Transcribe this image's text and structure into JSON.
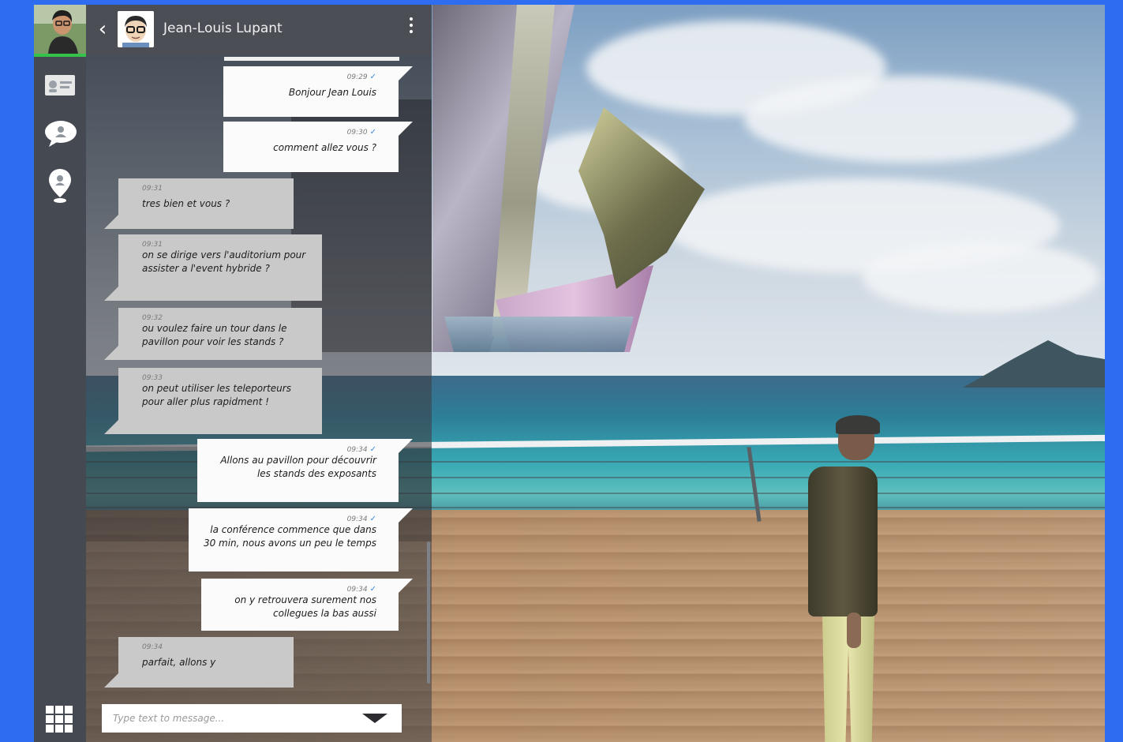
{
  "chat": {
    "contact_name": "Jean-Louis Lupant",
    "composer_placeholder": "Type text to message...",
    "messages": [
      {
        "direction": "out",
        "time": "09:29",
        "text": "Bonjour Jean Louis"
      },
      {
        "direction": "out",
        "time": "09:30",
        "text": "comment allez vous ?"
      },
      {
        "direction": "in",
        "time": "09:31",
        "text": "tres bien et vous ?"
      },
      {
        "direction": "in",
        "time": "09:31",
        "text": "on se dirige vers l'auditorium pour assister a l'event hybride ?"
      },
      {
        "direction": "in",
        "time": "09:32",
        "text": "ou voulez faire un tour dans le pavillon pour voir les stands ?"
      },
      {
        "direction": "in",
        "time": "09:33",
        "text": "on peut utiliser les teleporteurs pour aller plus rapidment !"
      },
      {
        "direction": "out",
        "time": "09:34",
        "text": "Allons au pavillon pour découvrir les stands des exposants"
      },
      {
        "direction": "out",
        "time": "09:34",
        "text": "la conférence commence que dans 30 min, nous avons un peu le temps"
      },
      {
        "direction": "out",
        "time": "09:34",
        "text": "on y retrouvera surement nos collegues la bas aussi"
      },
      {
        "direction": "in",
        "time": "09:34",
        "text": "parfait, allons y"
      }
    ]
  },
  "icons": {
    "back": "chevron-left-icon",
    "menu": "more-vertical-icon",
    "send": "send-icon",
    "contacts": "contact-card-icon",
    "chat": "chat-bubble-icon",
    "location": "map-pin-icon",
    "apps": "grid-icon",
    "read_receipt": "check-icon"
  },
  "colors": {
    "frame": "#2f6df0",
    "online_status": "#35c24b",
    "read_tick": "#3c8be0"
  }
}
